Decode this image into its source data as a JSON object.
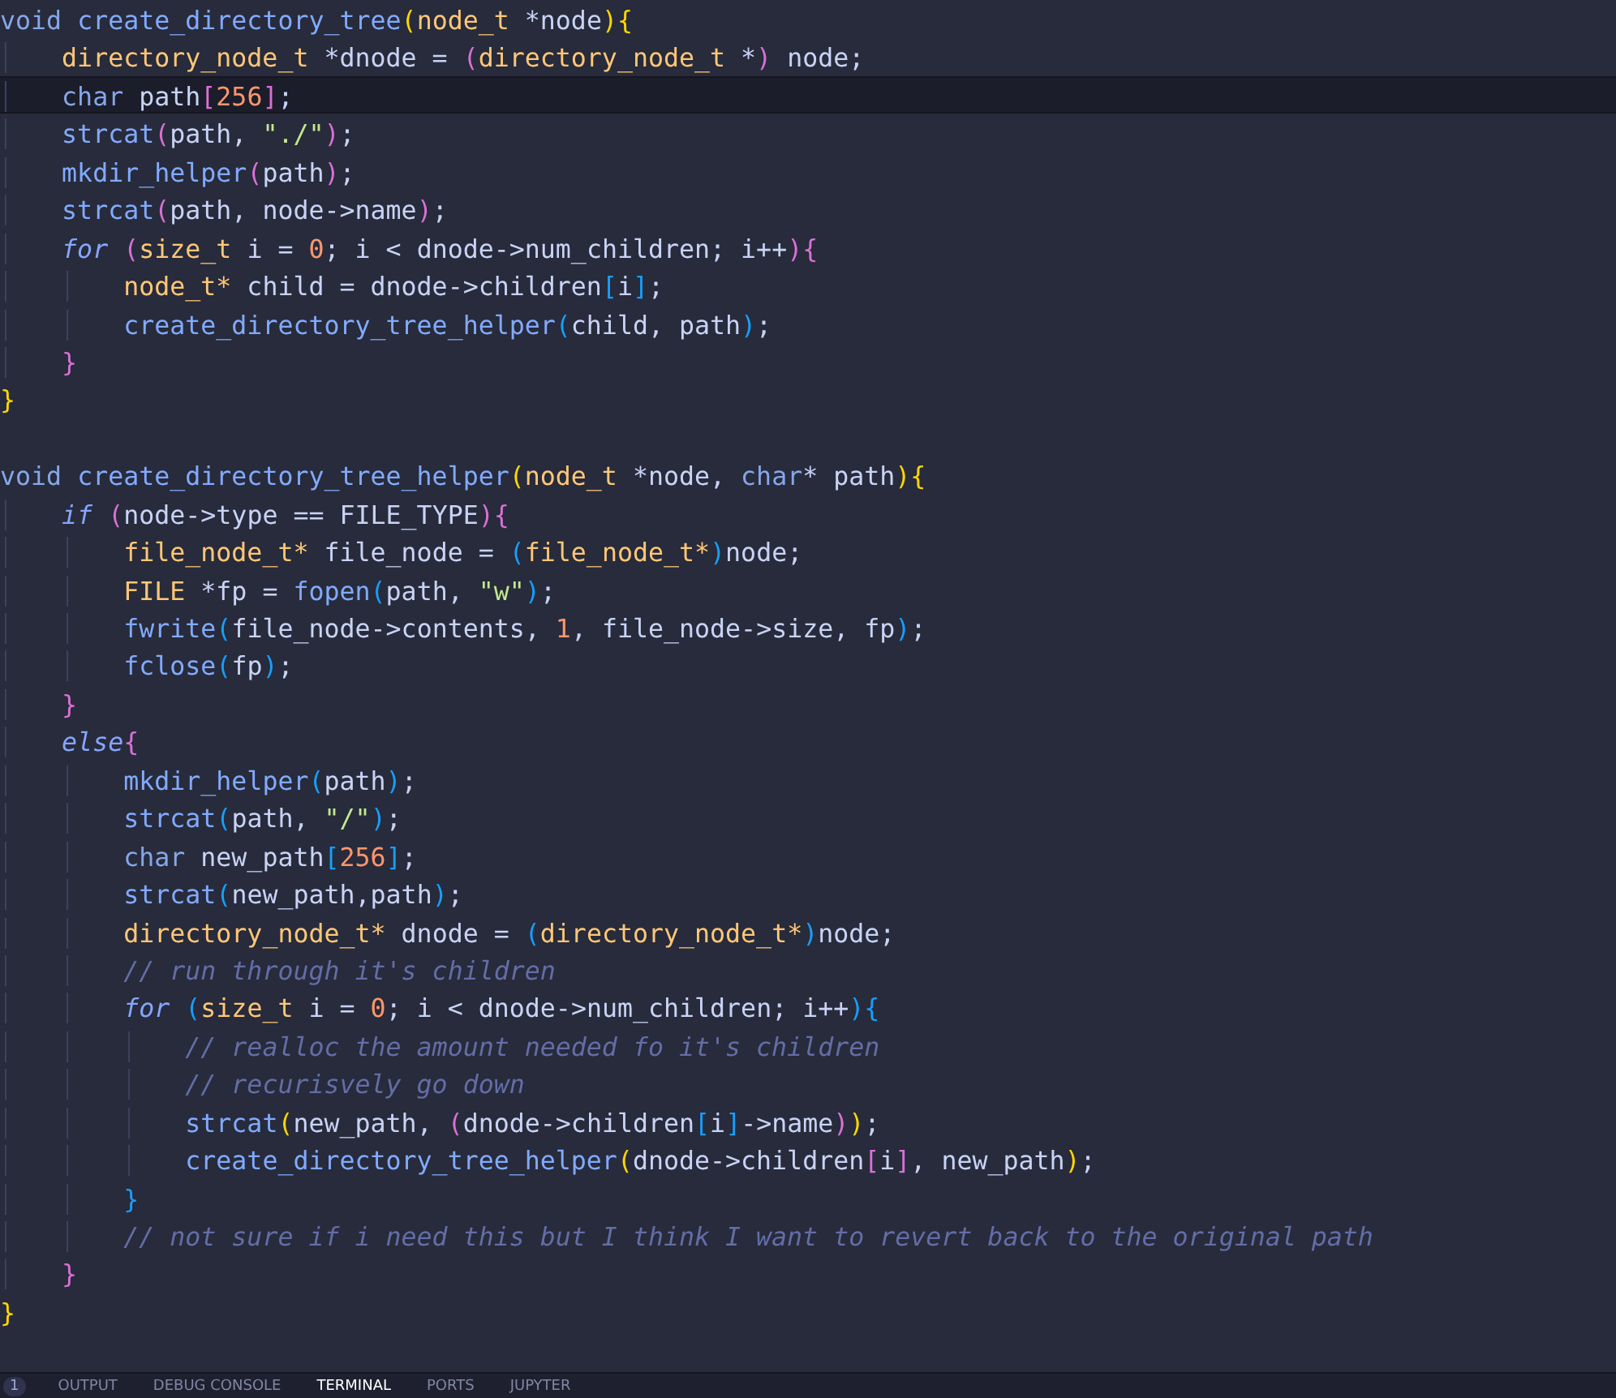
{
  "lines": [
    {
      "selected": false,
      "tokens": [
        {
          "kind": "keyword",
          "text": "void "
        },
        {
          "kind": "function",
          "text": "create_directory_tree"
        },
        {
          "kind": "bracket1",
          "text": "("
        },
        {
          "kind": "type",
          "text": "node_t"
        },
        {
          "kind": "plain",
          "text": " *node"
        },
        {
          "kind": "bracket1",
          "text": "){"
        }
      ]
    },
    {
      "selected": false,
      "tokens": [
        {
          "kind": "type",
          "text": "    directory_node_t"
        },
        {
          "kind": "plain",
          "text": " *dnode = "
        },
        {
          "kind": "bracket2",
          "text": "("
        },
        {
          "kind": "type",
          "text": "directory_node_t"
        },
        {
          "kind": "plain",
          "text": " *"
        },
        {
          "kind": "bracket2",
          "text": ")"
        },
        {
          "kind": "plain",
          "text": " node;"
        }
      ]
    },
    {
      "selected": true,
      "tokens": [
        {
          "kind": "keyword",
          "text": "    char"
        },
        {
          "kind": "plain",
          "text": " path"
        },
        {
          "kind": "bracket2",
          "text": "["
        },
        {
          "kind": "number",
          "text": "256"
        },
        {
          "kind": "bracket2",
          "text": "]"
        },
        {
          "kind": "plain",
          "text": ";"
        }
      ]
    },
    {
      "selected": false,
      "tokens": [
        {
          "kind": "function",
          "text": "    strcat"
        },
        {
          "kind": "bracket2",
          "text": "("
        },
        {
          "kind": "plain",
          "text": "path, "
        },
        {
          "kind": "string",
          "text": "\"./\""
        },
        {
          "kind": "bracket2",
          "text": ")"
        },
        {
          "kind": "plain",
          "text": ";"
        }
      ]
    },
    {
      "selected": false,
      "tokens": [
        {
          "kind": "function",
          "text": "    mkdir_helper"
        },
        {
          "kind": "bracket2",
          "text": "("
        },
        {
          "kind": "plain",
          "text": "path"
        },
        {
          "kind": "bracket2",
          "text": ")"
        },
        {
          "kind": "plain",
          "text": ";"
        }
      ]
    },
    {
      "selected": false,
      "tokens": [
        {
          "kind": "function",
          "text": "    strcat"
        },
        {
          "kind": "bracket2",
          "text": "("
        },
        {
          "kind": "plain",
          "text": "path, node->name"
        },
        {
          "kind": "bracket2",
          "text": ")"
        },
        {
          "kind": "plain",
          "text": ";"
        }
      ]
    },
    {
      "selected": false,
      "tokens": [
        {
          "kind": "control",
          "text": "    for "
        },
        {
          "kind": "bracket2",
          "text": "("
        },
        {
          "kind": "type",
          "text": "size_t"
        },
        {
          "kind": "plain",
          "text": " i = "
        },
        {
          "kind": "number",
          "text": "0"
        },
        {
          "kind": "plain",
          "text": "; i < dnode->num_children; i++"
        },
        {
          "kind": "bracket2",
          "text": "){"
        }
      ]
    },
    {
      "selected": false,
      "tokens": [
        {
          "kind": "type",
          "text": "        node_t*"
        },
        {
          "kind": "plain",
          "text": " child = dnode->children"
        },
        {
          "kind": "bracket3",
          "text": "["
        },
        {
          "kind": "plain",
          "text": "i"
        },
        {
          "kind": "bracket3",
          "text": "]"
        },
        {
          "kind": "plain",
          "text": ";"
        }
      ]
    },
    {
      "selected": false,
      "tokens": [
        {
          "kind": "function",
          "text": "        create_directory_tree_helper"
        },
        {
          "kind": "bracket3",
          "text": "("
        },
        {
          "kind": "plain",
          "text": "child, path"
        },
        {
          "kind": "bracket3",
          "text": ")"
        },
        {
          "kind": "plain",
          "text": ";"
        }
      ]
    },
    {
      "selected": false,
      "tokens": [
        {
          "kind": "bracket2",
          "text": "    }"
        }
      ]
    },
    {
      "selected": false,
      "tokens": [
        {
          "kind": "bracket1",
          "text": "}"
        }
      ]
    },
    {
      "selected": false
    },
    {
      "selected": false,
      "tokens": [
        {
          "kind": "keyword",
          "text": "void "
        },
        {
          "kind": "function",
          "text": "create_directory_tree_helper"
        },
        {
          "kind": "bracket1",
          "text": "("
        },
        {
          "kind": "type",
          "text": "node_t"
        },
        {
          "kind": "plain",
          "text": " *node, "
        },
        {
          "kind": "keyword",
          "text": "char"
        },
        {
          "kind": "plain",
          "text": "* path"
        },
        {
          "kind": "bracket1",
          "text": "){"
        }
      ]
    },
    {
      "selected": false,
      "tokens": [
        {
          "kind": "control",
          "text": "    if "
        },
        {
          "kind": "bracket2",
          "text": "("
        },
        {
          "kind": "plain",
          "text": "node->type == FILE_TYPE"
        },
        {
          "kind": "bracket2",
          "text": "){"
        }
      ]
    },
    {
      "selected": false,
      "tokens": [
        {
          "kind": "type",
          "text": "        file_node_t*"
        },
        {
          "kind": "plain",
          "text": " file_node = "
        },
        {
          "kind": "bracket3",
          "text": "("
        },
        {
          "kind": "type",
          "text": "file_node_t*"
        },
        {
          "kind": "bracket3",
          "text": ")"
        },
        {
          "kind": "plain",
          "text": "node;"
        }
      ]
    },
    {
      "selected": false,
      "tokens": [
        {
          "kind": "type",
          "text": "        FILE"
        },
        {
          "kind": "plain",
          "text": " *fp = "
        },
        {
          "kind": "function",
          "text": "fopen"
        },
        {
          "kind": "bracket3",
          "text": "("
        },
        {
          "kind": "plain",
          "text": "path, "
        },
        {
          "kind": "string",
          "text": "\"w\""
        },
        {
          "kind": "bracket3",
          "text": ")"
        },
        {
          "kind": "plain",
          "text": ";"
        }
      ]
    },
    {
      "selected": false,
      "tokens": [
        {
          "kind": "function",
          "text": "        fwrite"
        },
        {
          "kind": "bracket3",
          "text": "("
        },
        {
          "kind": "plain",
          "text": "file_node->contents, "
        },
        {
          "kind": "number",
          "text": "1"
        },
        {
          "kind": "plain",
          "text": ", file_node->size, fp"
        },
        {
          "kind": "bracket3",
          "text": ")"
        },
        {
          "kind": "plain",
          "text": ";"
        }
      ]
    },
    {
      "selected": false,
      "tokens": [
        {
          "kind": "function",
          "text": "        fclose"
        },
        {
          "kind": "bracket3",
          "text": "("
        },
        {
          "kind": "plain",
          "text": "fp"
        },
        {
          "kind": "bracket3",
          "text": ")"
        },
        {
          "kind": "plain",
          "text": ";"
        }
      ]
    },
    {
      "selected": false,
      "tokens": [
        {
          "kind": "bracket2",
          "text": "    }"
        }
      ]
    },
    {
      "selected": false,
      "tokens": [
        {
          "kind": "control",
          "text": "    else"
        },
        {
          "kind": "bracket2",
          "text": "{"
        }
      ]
    },
    {
      "selected": false,
      "tokens": [
        {
          "kind": "function",
          "text": "        mkdir_helper"
        },
        {
          "kind": "bracket3",
          "text": "("
        },
        {
          "kind": "plain",
          "text": "path"
        },
        {
          "kind": "bracket3",
          "text": ")"
        },
        {
          "kind": "plain",
          "text": ";"
        }
      ]
    },
    {
      "selected": false,
      "tokens": [
        {
          "kind": "function",
          "text": "        strcat"
        },
        {
          "kind": "bracket3",
          "text": "("
        },
        {
          "kind": "plain",
          "text": "path, "
        },
        {
          "kind": "string",
          "text": "\"/\""
        },
        {
          "kind": "bracket3",
          "text": ")"
        },
        {
          "kind": "plain",
          "text": ";"
        }
      ]
    },
    {
      "selected": false,
      "tokens": [
        {
          "kind": "keyword",
          "text": "        char"
        },
        {
          "kind": "plain",
          "text": " new_path"
        },
        {
          "kind": "bracket3",
          "text": "["
        },
        {
          "kind": "number",
          "text": "256"
        },
        {
          "kind": "bracket3",
          "text": "]"
        },
        {
          "kind": "plain",
          "text": ";"
        }
      ]
    },
    {
      "selected": false,
      "tokens": [
        {
          "kind": "function",
          "text": "        strcat"
        },
        {
          "kind": "bracket3",
          "text": "("
        },
        {
          "kind": "plain",
          "text": "new_path,path"
        },
        {
          "kind": "bracket3",
          "text": ")"
        },
        {
          "kind": "plain",
          "text": ";"
        }
      ]
    },
    {
      "selected": false,
      "tokens": [
        {
          "kind": "type",
          "text": "        directory_node_t*"
        },
        {
          "kind": "plain",
          "text": " dnode = "
        },
        {
          "kind": "bracket3",
          "text": "("
        },
        {
          "kind": "type",
          "text": "directory_node_t*"
        },
        {
          "kind": "bracket3",
          "text": ")"
        },
        {
          "kind": "plain",
          "text": "node;"
        }
      ]
    },
    {
      "selected": false,
      "tokens": [
        {
          "kind": "comment",
          "text": "        // run through it's children"
        }
      ]
    },
    {
      "selected": false,
      "tokens": [
        {
          "kind": "control",
          "text": "        for "
        },
        {
          "kind": "bracket3",
          "text": "("
        },
        {
          "kind": "type",
          "text": "size_t"
        },
        {
          "kind": "plain",
          "text": " i = "
        },
        {
          "kind": "number",
          "text": "0"
        },
        {
          "kind": "plain",
          "text": "; i < dnode->num_children; i++"
        },
        {
          "kind": "bracket3",
          "text": "){"
        }
      ]
    },
    {
      "selected": false,
      "tokens": [
        {
          "kind": "comment",
          "text": "            // realloc the amount needed fo it's children"
        }
      ]
    },
    {
      "selected": false,
      "tokens": [
        {
          "kind": "comment",
          "text": "            // recurisvely go down"
        }
      ]
    },
    {
      "selected": false,
      "tokens": [
        {
          "kind": "function",
          "text": "            strcat"
        },
        {
          "kind": "bracket1",
          "text": "("
        },
        {
          "kind": "plain",
          "text": "new_path, "
        },
        {
          "kind": "bracket2",
          "text": "("
        },
        {
          "kind": "plain",
          "text": "dnode->children"
        },
        {
          "kind": "bracket3",
          "text": "["
        },
        {
          "kind": "plain",
          "text": "i"
        },
        {
          "kind": "bracket3",
          "text": "]"
        },
        {
          "kind": "plain",
          "text": "->name"
        },
        {
          "kind": "bracket2",
          "text": ")"
        },
        {
          "kind": "bracket1",
          "text": ")"
        },
        {
          "kind": "plain",
          "text": ";"
        }
      ]
    },
    {
      "selected": false,
      "tokens": [
        {
          "kind": "function",
          "text": "            create_directory_tree_helper"
        },
        {
          "kind": "bracket1",
          "text": "("
        },
        {
          "kind": "plain",
          "text": "dnode->children"
        },
        {
          "kind": "bracket2",
          "text": "["
        },
        {
          "kind": "plain",
          "text": "i"
        },
        {
          "kind": "bracket2",
          "text": "]"
        },
        {
          "kind": "plain",
          "text": ", new_path"
        },
        {
          "kind": "bracket1",
          "text": ")"
        },
        {
          "kind": "plain",
          "text": ";"
        }
      ]
    },
    {
      "selected": false,
      "tokens": [
        {
          "kind": "bracket3",
          "text": "        }"
        }
      ]
    },
    {
      "selected": false,
      "tokens": [
        {
          "kind": "comment",
          "text": "        // not sure if i need this but I think I want to revert back to the original path"
        }
      ]
    },
    {
      "selected": false,
      "tokens": [
        {
          "kind": "bracket2",
          "text": "    }"
        }
      ]
    },
    {
      "selected": false,
      "tokens": [
        {
          "kind": "bracket1",
          "text": "}"
        }
      ]
    }
  ],
  "panel": {
    "badge": "1",
    "tabs": [
      {
        "label": "OUTPUT",
        "selected": false
      },
      {
        "label": "DEBUG CONSOLE",
        "selected": false
      },
      {
        "label": "TERMINAL",
        "selected": true
      },
      {
        "label": "PORTS",
        "selected": false
      },
      {
        "label": "JUPYTER",
        "selected": false
      }
    ]
  }
}
